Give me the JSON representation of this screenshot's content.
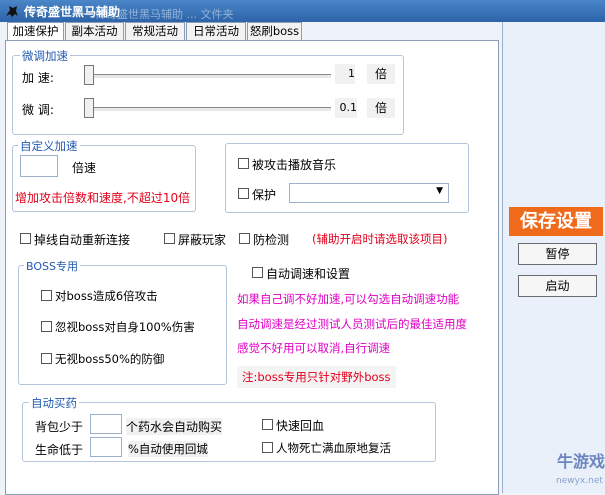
{
  "window": {
    "title": "传奇盛世黑马辅助",
    "ghost_title": "传奇盛世黑马辅助 ... 文件夹"
  },
  "tabs": [
    {
      "label": "加速保护"
    },
    {
      "label": "副本活动"
    },
    {
      "label": "常规活动"
    },
    {
      "label": "日常活动"
    },
    {
      "label": "怒刷boss"
    }
  ],
  "fine_tune": {
    "legend": "微调加速",
    "speed_label": "加  速:",
    "speed_value": "1",
    "speed_unit": "倍",
    "speed_level": 0,
    "micro_label": "微  调:",
    "micro_value": "0.1",
    "micro_unit": "倍",
    "micro_level": 0
  },
  "custom": {
    "legend": "自定义加速",
    "multiplier_value": "",
    "multiplier_unit": "倍速",
    "warning": "增加攻击倍数和速度,不超过10倍"
  },
  "attack": {
    "play_music_label": "被攻击播放音乐",
    "protect_label": "保护",
    "protect_value": ""
  },
  "options": {
    "reconnect_label": "掉线自动重新连接",
    "hide_players_label": "屏蔽玩家",
    "anti_detect_label": "防检测",
    "anti_detect_note": "(辅助开启时请选取该项目)",
    "auto_tune_label": "自动调速和设置"
  },
  "boss": {
    "legend": "BOSS专用",
    "items": [
      {
        "label": "对boss造成6倍攻击"
      },
      {
        "label": "忽视boss对自身100%伤害"
      },
      {
        "label": "无视boss50%的防御"
      }
    ]
  },
  "tips": {
    "line1": "如果自己调不好加速,可以勾选自动调速功能",
    "line2": "自动调速是经过测试人员测试后的最佳适用度",
    "line3": "感觉不好用可以取消,自行调速",
    "note": "注:boss专用只针对野外boss"
  },
  "auto_buy": {
    "legend": "自动买药",
    "bag_label": "背包少于",
    "bag_value": "",
    "bag_suffix": "个药水会自动购买",
    "hp_label": "生命低于",
    "hp_value": "",
    "hp_suffix": "%自动使用回城",
    "quick_heal_label": "快速回血",
    "revive_label": "人物死亡满血原地复活"
  },
  "right": {
    "save_label": "保存设置",
    "pause_label": "暂停",
    "start_label": "启动"
  },
  "watermark": {
    "text": "牛游戏",
    "sub": "newyx.net"
  },
  "colors": {
    "accent": "#f06a1b",
    "warning": "#e0001a",
    "tips": "#e000c4",
    "legend": "#2159b0"
  }
}
